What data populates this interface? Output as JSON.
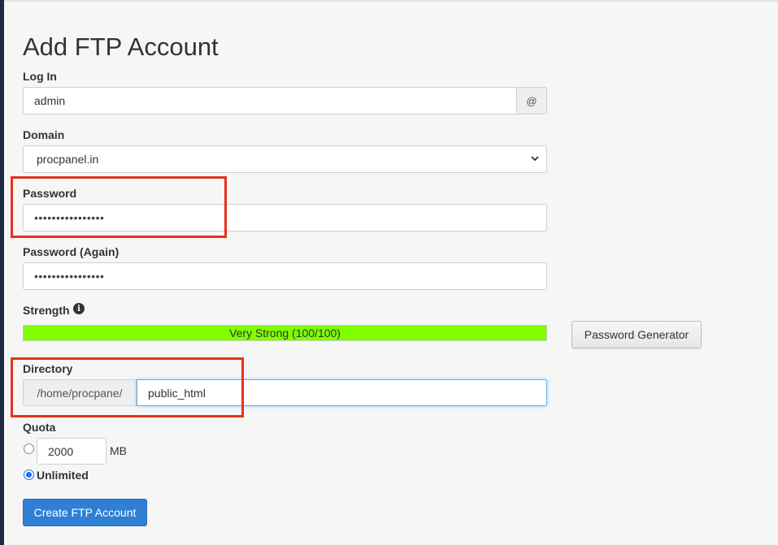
{
  "page": {
    "title": "Add FTP Account"
  },
  "login": {
    "label": "Log In",
    "value": "admin",
    "addon": "@"
  },
  "domain": {
    "label": "Domain",
    "selected": "procpanel.in"
  },
  "password": {
    "label": "Password",
    "masked": "••••••••••••••••"
  },
  "password_again": {
    "label": "Password (Again)",
    "masked": "••••••••••••••••"
  },
  "strength": {
    "label": "Strength",
    "bar_text": "Very Strong (100/100)",
    "score": 100,
    "color": "#80ff00"
  },
  "password_generator": {
    "label": "Password Generator"
  },
  "directory": {
    "label": "Directory",
    "prefix": "/home/procpane/",
    "value": "public_html"
  },
  "quota": {
    "label": "Quota",
    "value": "2000",
    "unit": "MB",
    "unlimited_label": "Unlimited",
    "selected": "Unlimited"
  },
  "submit": {
    "label": "Create FTP Account"
  },
  "colors": {
    "primary": "#2f7fd3",
    "highlight": "#e5331b",
    "strength": "#80ff00"
  }
}
